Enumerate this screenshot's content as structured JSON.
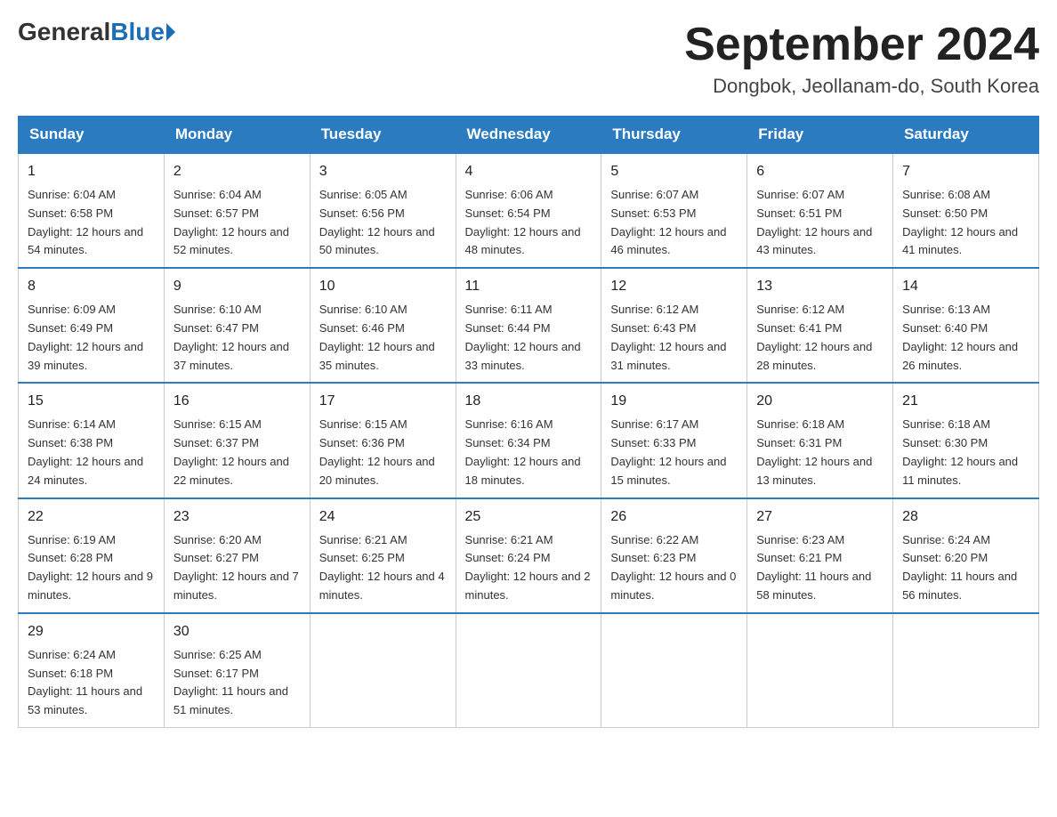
{
  "header": {
    "logo_general": "General",
    "logo_blue": "Blue",
    "month_title": "September 2024",
    "location": "Dongbok, Jeollanam-do, South Korea"
  },
  "days_of_week": [
    "Sunday",
    "Monday",
    "Tuesday",
    "Wednesday",
    "Thursday",
    "Friday",
    "Saturday"
  ],
  "weeks": [
    [
      {
        "day": "1",
        "sunrise": "Sunrise: 6:04 AM",
        "sunset": "Sunset: 6:58 PM",
        "daylight": "Daylight: 12 hours and 54 minutes."
      },
      {
        "day": "2",
        "sunrise": "Sunrise: 6:04 AM",
        "sunset": "Sunset: 6:57 PM",
        "daylight": "Daylight: 12 hours and 52 minutes."
      },
      {
        "day": "3",
        "sunrise": "Sunrise: 6:05 AM",
        "sunset": "Sunset: 6:56 PM",
        "daylight": "Daylight: 12 hours and 50 minutes."
      },
      {
        "day": "4",
        "sunrise": "Sunrise: 6:06 AM",
        "sunset": "Sunset: 6:54 PM",
        "daylight": "Daylight: 12 hours and 48 minutes."
      },
      {
        "day": "5",
        "sunrise": "Sunrise: 6:07 AM",
        "sunset": "Sunset: 6:53 PM",
        "daylight": "Daylight: 12 hours and 46 minutes."
      },
      {
        "day": "6",
        "sunrise": "Sunrise: 6:07 AM",
        "sunset": "Sunset: 6:51 PM",
        "daylight": "Daylight: 12 hours and 43 minutes."
      },
      {
        "day": "7",
        "sunrise": "Sunrise: 6:08 AM",
        "sunset": "Sunset: 6:50 PM",
        "daylight": "Daylight: 12 hours and 41 minutes."
      }
    ],
    [
      {
        "day": "8",
        "sunrise": "Sunrise: 6:09 AM",
        "sunset": "Sunset: 6:49 PM",
        "daylight": "Daylight: 12 hours and 39 minutes."
      },
      {
        "day": "9",
        "sunrise": "Sunrise: 6:10 AM",
        "sunset": "Sunset: 6:47 PM",
        "daylight": "Daylight: 12 hours and 37 minutes."
      },
      {
        "day": "10",
        "sunrise": "Sunrise: 6:10 AM",
        "sunset": "Sunset: 6:46 PM",
        "daylight": "Daylight: 12 hours and 35 minutes."
      },
      {
        "day": "11",
        "sunrise": "Sunrise: 6:11 AM",
        "sunset": "Sunset: 6:44 PM",
        "daylight": "Daylight: 12 hours and 33 minutes."
      },
      {
        "day": "12",
        "sunrise": "Sunrise: 6:12 AM",
        "sunset": "Sunset: 6:43 PM",
        "daylight": "Daylight: 12 hours and 31 minutes."
      },
      {
        "day": "13",
        "sunrise": "Sunrise: 6:12 AM",
        "sunset": "Sunset: 6:41 PM",
        "daylight": "Daylight: 12 hours and 28 minutes."
      },
      {
        "day": "14",
        "sunrise": "Sunrise: 6:13 AM",
        "sunset": "Sunset: 6:40 PM",
        "daylight": "Daylight: 12 hours and 26 minutes."
      }
    ],
    [
      {
        "day": "15",
        "sunrise": "Sunrise: 6:14 AM",
        "sunset": "Sunset: 6:38 PM",
        "daylight": "Daylight: 12 hours and 24 minutes."
      },
      {
        "day": "16",
        "sunrise": "Sunrise: 6:15 AM",
        "sunset": "Sunset: 6:37 PM",
        "daylight": "Daylight: 12 hours and 22 minutes."
      },
      {
        "day": "17",
        "sunrise": "Sunrise: 6:15 AM",
        "sunset": "Sunset: 6:36 PM",
        "daylight": "Daylight: 12 hours and 20 minutes."
      },
      {
        "day": "18",
        "sunrise": "Sunrise: 6:16 AM",
        "sunset": "Sunset: 6:34 PM",
        "daylight": "Daylight: 12 hours and 18 minutes."
      },
      {
        "day": "19",
        "sunrise": "Sunrise: 6:17 AM",
        "sunset": "Sunset: 6:33 PM",
        "daylight": "Daylight: 12 hours and 15 minutes."
      },
      {
        "day": "20",
        "sunrise": "Sunrise: 6:18 AM",
        "sunset": "Sunset: 6:31 PM",
        "daylight": "Daylight: 12 hours and 13 minutes."
      },
      {
        "day": "21",
        "sunrise": "Sunrise: 6:18 AM",
        "sunset": "Sunset: 6:30 PM",
        "daylight": "Daylight: 12 hours and 11 minutes."
      }
    ],
    [
      {
        "day": "22",
        "sunrise": "Sunrise: 6:19 AM",
        "sunset": "Sunset: 6:28 PM",
        "daylight": "Daylight: 12 hours and 9 minutes."
      },
      {
        "day": "23",
        "sunrise": "Sunrise: 6:20 AM",
        "sunset": "Sunset: 6:27 PM",
        "daylight": "Daylight: 12 hours and 7 minutes."
      },
      {
        "day": "24",
        "sunrise": "Sunrise: 6:21 AM",
        "sunset": "Sunset: 6:25 PM",
        "daylight": "Daylight: 12 hours and 4 minutes."
      },
      {
        "day": "25",
        "sunrise": "Sunrise: 6:21 AM",
        "sunset": "Sunset: 6:24 PM",
        "daylight": "Daylight: 12 hours and 2 minutes."
      },
      {
        "day": "26",
        "sunrise": "Sunrise: 6:22 AM",
        "sunset": "Sunset: 6:23 PM",
        "daylight": "Daylight: 12 hours and 0 minutes."
      },
      {
        "day": "27",
        "sunrise": "Sunrise: 6:23 AM",
        "sunset": "Sunset: 6:21 PM",
        "daylight": "Daylight: 11 hours and 58 minutes."
      },
      {
        "day": "28",
        "sunrise": "Sunrise: 6:24 AM",
        "sunset": "Sunset: 6:20 PM",
        "daylight": "Daylight: 11 hours and 56 minutes."
      }
    ],
    [
      {
        "day": "29",
        "sunrise": "Sunrise: 6:24 AM",
        "sunset": "Sunset: 6:18 PM",
        "daylight": "Daylight: 11 hours and 53 minutes."
      },
      {
        "day": "30",
        "sunrise": "Sunrise: 6:25 AM",
        "sunset": "Sunset: 6:17 PM",
        "daylight": "Daylight: 11 hours and 51 minutes."
      },
      null,
      null,
      null,
      null,
      null
    ]
  ]
}
